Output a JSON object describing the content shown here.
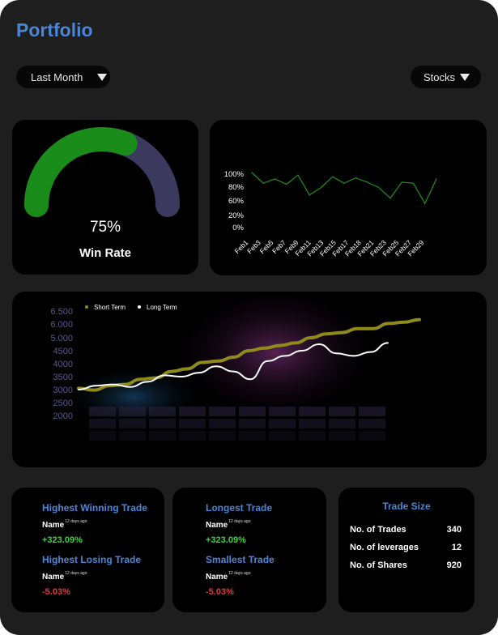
{
  "title": "Portfolio",
  "filters": {
    "period": "Last Month",
    "asset": "Stocks"
  },
  "win_rate": {
    "value": 75,
    "value_label": "75%",
    "label": "Win Rate",
    "colors": {
      "fill": "#1a8c1a",
      "rest": "#3b3a5e"
    }
  },
  "chart_data": [
    {
      "type": "line",
      "categories": [
        "Feb1",
        "Feb3",
        "Feb5",
        "Feb7",
        "Feb9",
        "Feb11",
        "Feb13",
        "Feb15",
        "Feb17",
        "Feb18",
        "Feb21",
        "Feb23",
        "Feb25",
        "Feb27",
        "Feb29"
      ],
      "y_ticks": [
        "100%",
        "80%",
        "60%",
        "20%",
        "0%"
      ],
      "series": [
        {
          "color": "#1f8f1f",
          "values": [
            100,
            80,
            88,
            78,
            95,
            58,
            72,
            92,
            80,
            90,
            82,
            72,
            52,
            82,
            80,
            42,
            88
          ]
        }
      ]
    },
    {
      "type": "line",
      "y_ticks": [
        "6.500",
        "6.000",
        "5.000",
        "4500",
        "4000",
        "3500",
        "3000",
        "2500",
        "2000"
      ],
      "legend_position": "top-left",
      "series": [
        {
          "name": "Short Term",
          "color": "#8f8a1a",
          "values": [
            3050,
            2980,
            3150,
            3200,
            3400,
            3450,
            3700,
            3800,
            4050,
            4100,
            4250,
            4500,
            4600,
            4700,
            4800,
            5000,
            5150,
            5200,
            5350,
            5350,
            5550,
            5600,
            5700
          ]
        },
        {
          "name": "Long Term",
          "color": "#ffffff",
          "values": [
            3000,
            3150,
            3200,
            3100,
            3300,
            3550,
            3500,
            3650,
            3900,
            3700,
            3400,
            4100,
            4300,
            4500,
            4750,
            4400,
            4300,
            4450,
            4800
          ]
        }
      ]
    }
  ],
  "stats_left": {
    "winning_title": "Highest Winning Trade",
    "winning_name": "Name",
    "winning_time": "12 days ago",
    "winning_value": "+323.09%",
    "losing_title": "Highest Losing Trade",
    "losing_name": "Name",
    "losing_time": "12 days ago",
    "losing_value": "-5.03%"
  },
  "stats_middle": {
    "longest_title": "Longest Trade",
    "longest_name": "Name",
    "longest_time": "12 days ago",
    "longest_value": "+323.09%",
    "smallest_title": "Smallest Trade",
    "smallest_name": "Name",
    "smallest_time": "12 days ago",
    "smallest_value": "-5.03%"
  },
  "trade_size": {
    "title": "Trade Size",
    "rows": [
      {
        "label": "No. of Trades",
        "value": "340"
      },
      {
        "label": "No. of leverages",
        "value": "12"
      },
      {
        "label": "No. of Shares",
        "value": "920"
      }
    ]
  }
}
